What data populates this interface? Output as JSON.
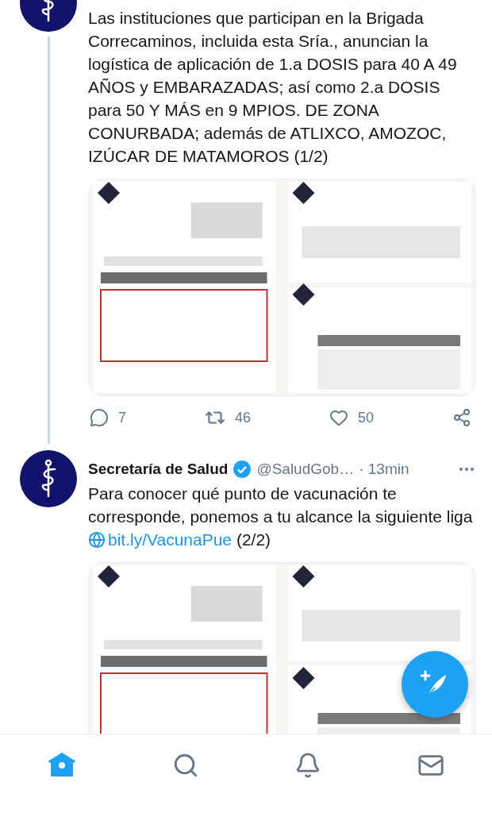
{
  "tweets": [
    {
      "text": "Las instituciones que participan en la Brigada Correcaminos, incluida esta Sría., anuncian la logística de aplicación de 1.a DOSIS para 40 A 49 AÑOS y EMBARAZADAS; así como 2.a DOSIS para 50 Y MÁS en 9 MPIOS. DE ZONA CONURBADA; además de ATLIXCO, AMOZOC, IZÚCAR DE MATAMOROS (1/2)",
      "actions": [
        {
          "kind": "reply",
          "count": "7"
        },
        {
          "kind": "retweet",
          "count": "46"
        },
        {
          "kind": "like",
          "count": "50"
        },
        {
          "kind": "share"
        }
      ]
    },
    {
      "author": "Secretaría de Salud",
      "verified": true,
      "handle": "@SaludGob…",
      "time": "· 13min",
      "text": "Para conocer qué punto de vacunación te corresponde, ponemos a tu alcance la siguiente liga",
      "link": "bit.ly/VacunaPue",
      "text_after": "(2/2)"
    }
  ],
  "nav": [
    {
      "kind": "home",
      "selected": true
    },
    {
      "kind": "search",
      "selected": false
    },
    {
      "kind": "notifications",
      "selected": false
    },
    {
      "kind": "messages",
      "selected": false
    }
  ]
}
